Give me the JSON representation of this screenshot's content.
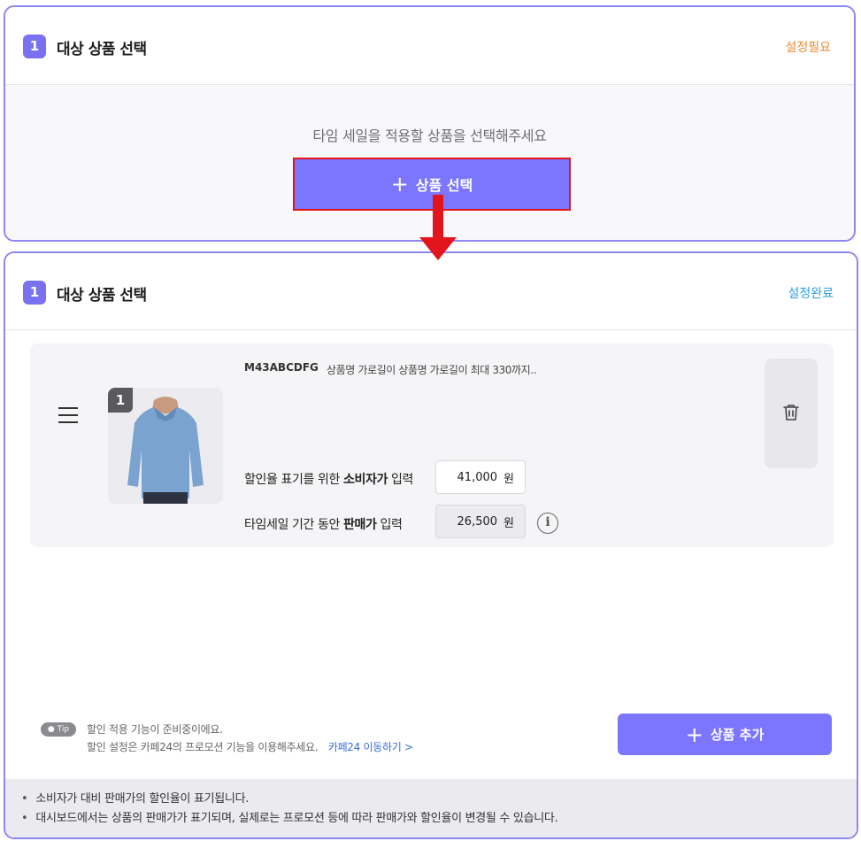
{
  "top_card": {
    "step_number": "1",
    "title": "대상 상품 선택",
    "status": "설정필요",
    "guide_text": "타임 세일을 적용할 상품을 선택해주세요",
    "select_button_label": "상품 선택",
    "select_button_icon": "plus-icon"
  },
  "bottom_card": {
    "step_number": "1",
    "title": "대상 상품 선택",
    "status": "설정완료",
    "product": {
      "index": "1",
      "code": "M43ABCDFG",
      "name": "상품명 가로길이 상품명 가로길이 최대 330까지..",
      "consumer_label_prefix": "할인율 표기를 위한",
      "consumer_label_bold": "소비자가",
      "consumer_label_suffix": "입력",
      "consumer_price": "41,000",
      "sale_label_prefix": "타임세일 기간 동안",
      "sale_label_bold": "판매가",
      "sale_label_suffix": "입력",
      "sale_price": "26,500",
      "currency": "원",
      "info_icon": "i"
    },
    "tip": {
      "badge": "Tip",
      "line1": "할인 적용 기능이 준비중이에요.",
      "line2": "할인 설정은 카페24의 프로모션 기능을 이용해주세요.",
      "link": "카페24 이동하기 >"
    },
    "add_button_label": "상품 추가",
    "notes": [
      "소비자가 대비 판매가의 할인율이 표기됩니다.",
      "대시보드에서는 상품의 판매가가 표기되며, 실제로는 프로모션 등에 따라 판매가와 할인율이 변경될 수 있습니다."
    ]
  },
  "colors": {
    "accent": "#7c76ff",
    "border": "#8f86f0",
    "status_warn": "#ee8a2a",
    "status_done": "#2d9de0",
    "highlight": "#e2141c"
  }
}
